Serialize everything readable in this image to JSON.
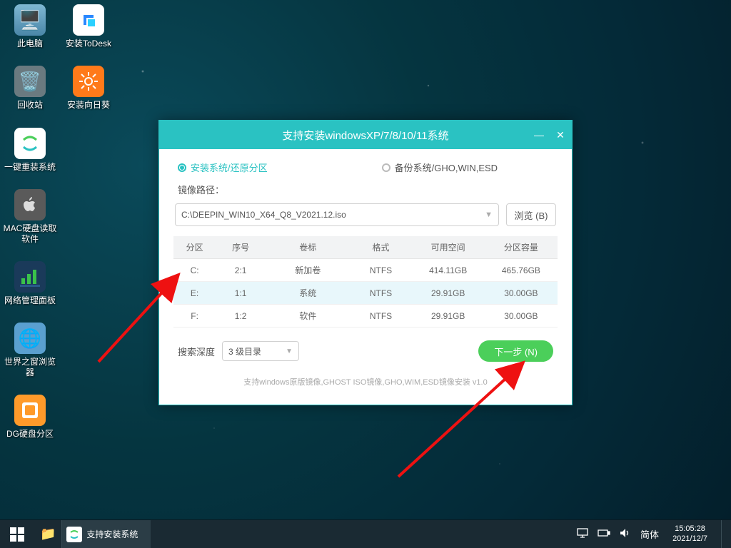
{
  "desktop": {
    "col1": [
      {
        "name": "pc",
        "label": "此电脑"
      },
      {
        "name": "trash",
        "label": "回收站"
      },
      {
        "name": "reinstall",
        "label": "一键重装系统"
      },
      {
        "name": "macread",
        "label": "MAC硬盘读取软件"
      },
      {
        "name": "netpanel",
        "label": "网络管理面板"
      },
      {
        "name": "worldbrowser",
        "label": "世界之窗浏览器"
      },
      {
        "name": "dgdisk",
        "label": "DG硬盘分区"
      }
    ],
    "col2": [
      {
        "name": "todesk",
        "label": "安装ToDesk"
      },
      {
        "name": "sunflower",
        "label": "安装向日葵"
      }
    ]
  },
  "installer": {
    "title": "支持安装windowsXP/7/8/10/11系统",
    "mode_install": "安装系统/还原分区",
    "mode_backup": "备份系统/GHO,WIN,ESD",
    "image_path_label": "镜像路径：",
    "image_path_value": "C:\\DEEPIN_WIN10_X64_Q8_V2021.12.iso",
    "browse_label": "浏览 (B)",
    "table": {
      "headers": [
        "分区",
        "序号",
        "卷标",
        "格式",
        "可用空间",
        "分区容量"
      ],
      "rows": [
        [
          "C:",
          "2:1",
          "新加卷",
          "NTFS",
          "414.11GB",
          "465.76GB"
        ],
        [
          "E:",
          "1:1",
          "系统",
          "NTFS",
          "29.91GB",
          "30.00GB"
        ],
        [
          "F:",
          "1:2",
          "软件",
          "NTFS",
          "29.91GB",
          "30.00GB"
        ]
      ],
      "selected_index": 1
    },
    "depth_label": "搜索深度",
    "depth_value": "3 级目录",
    "next_label": "下一步 (N)",
    "support_line": "支持windows原版镜像,GHOST ISO镜像,GHO,WIM,ESD镜像安装    v1.0"
  },
  "taskbar": {
    "task_label": "支持安装系统",
    "ime": "简体",
    "time": "15:05:28",
    "date": "2021/12/7"
  }
}
